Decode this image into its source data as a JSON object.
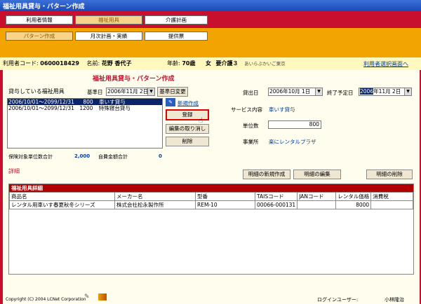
{
  "window": {
    "title": "福祉用具貸与・パターン作成"
  },
  "nav": {
    "row1": [
      "利用者情報",
      "福祉用具",
      "介護計画"
    ],
    "row2": [
      "パターン作成",
      "月次計画・実績",
      "提供票"
    ]
  },
  "info_bar": {
    "user_code_label": "利用者コード:",
    "user_code": "0600018429",
    "name_label": "名前:",
    "name": "花野 香代子",
    "age_label": "年齢:",
    "age": "70歳",
    "gender": "女",
    "care_level": "要介護３",
    "office": "あいらぶかいご東京",
    "user_select_link": "利用者選択画面へ"
  },
  "page_title": "福祉用具貸与・パターン作成",
  "rental": {
    "section_label": "貸与している福祉用具",
    "base_date_label": "基準日",
    "base_date": "2006年11月 2日",
    "base_date_change_button": "基準日変更",
    "items": [
      {
        "period": "2006/10/01～2099/12/31",
        "units": "800",
        "name": "車いす貸与",
        "selected": true
      },
      {
        "period": "2006/10/01～2099/12/31",
        "units": "1200",
        "name": "特殊寝台貸与",
        "selected": false
      }
    ],
    "new_create_link": "新規作成",
    "register_button": "登録",
    "cancel_edit_button": "編集の取り消し",
    "delete_button": "削除",
    "insured_total_label": "保険対象単位数合計",
    "insured_total": "2,000",
    "self_pay_total_label": "自費金額合計",
    "self_pay_total": "0"
  },
  "form": {
    "lending_date_label": "貸出日",
    "lending_date": "2006年10月 1日",
    "end_date_label": "終了予定日",
    "end_date_year": "2006",
    "end_date_rest": "年11月 2日",
    "service_label": "サービス内容",
    "service": "車いす貸与",
    "units_label": "単位数",
    "units": "800",
    "office_label": "事業所",
    "office": "楽にレンタルプラザ"
  },
  "detail": {
    "section_label": "詳細",
    "new_detail_button": "明細の新規作成",
    "edit_detail_button": "明細の編集",
    "delete_detail_button": "明細の削除",
    "table_title": "福祉用具詳細",
    "columns": [
      "商品名",
      "メーカー名",
      "型番",
      "TAISコード",
      "JANコード",
      "レンタル価格",
      "消費税"
    ],
    "rows": [
      [
        "レンタル用車いす春夏秋冬シリーズ",
        "株式会社松永製作所",
        "REM-10",
        "00066-000131",
        "",
        "8000",
        ""
      ]
    ]
  },
  "footer": {
    "copyright": "Copyright (C) 2004 LCNet Corporation",
    "login_user_label": "ログインユーザー:",
    "login_user": "小林隆治"
  }
}
